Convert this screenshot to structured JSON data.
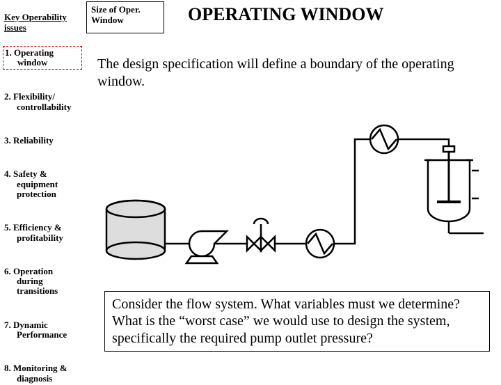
{
  "sidebar": {
    "title": "Key Operability issues",
    "items": [
      {
        "num": "1.",
        "l1": "Operating",
        "l2": "window",
        "active": true
      },
      {
        "num": "2.",
        "l1": "Flexibility/",
        "l2": "controllability",
        "active": false
      },
      {
        "num": "3.",
        "l1": "Reliability",
        "l2": "",
        "active": false
      },
      {
        "num": "4.",
        "l1": "Safety &",
        "l2": "equipment protection",
        "active": false
      },
      {
        "num": "5.",
        "l1": "Efficiency &",
        "l2": "profitability",
        "active": false
      },
      {
        "num": "6.",
        "l1": "Operation",
        "l2": "during transitions",
        "active": false
      },
      {
        "num": "7.",
        "l1": "Dynamic",
        "l2": "Performance",
        "active": false
      },
      {
        "num": "8.",
        "l1": "Monitoring &",
        "l2": "diagnosis",
        "active": false
      }
    ]
  },
  "header_box": "Size of Oper. Window",
  "title": "OPERATING WINDOW",
  "body_text": "The design specification will define a boundary of the operating window.",
  "question": "Consider the flow system.  What variables must we determine?  What is the “worst case” we would use to design the system, specifically the required pump outlet pressure?"
}
